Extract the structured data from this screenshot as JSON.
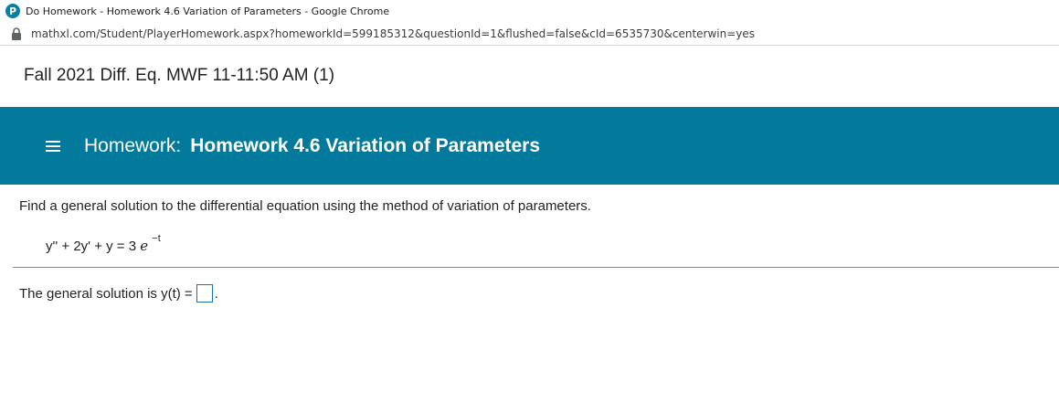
{
  "window": {
    "title": "Do Homework - Homework 4.6 Variation of Parameters - Google Chrome",
    "app_icon_letter": "P",
    "url": "mathxl.com/Student/PlayerHomework.aspx?homeworkId=599185312&questionId=1&flushed=false&cId=6535730&centerwin=yes"
  },
  "course": {
    "title": "Fall 2021 Diff. Eq. MWF 11-11:50 AM (1)"
  },
  "banner": {
    "label": "Homework:",
    "name": "Homework 4.6 Variation of Parameters",
    "color": "#03799b"
  },
  "question": {
    "prompt": "Find a general solution to the differential equation using the method of variation of parameters.",
    "equation_lhs": "y'' + 2y' + y = 3",
    "equation_e": "e",
    "equation_exp": "−t"
  },
  "answer": {
    "prefix": "The general solution is y(t) =",
    "value": "",
    "suffix": "."
  },
  "icons": {
    "app": "pearson-icon",
    "lock": "lock-icon",
    "menu": "hamburger-menu-icon"
  }
}
